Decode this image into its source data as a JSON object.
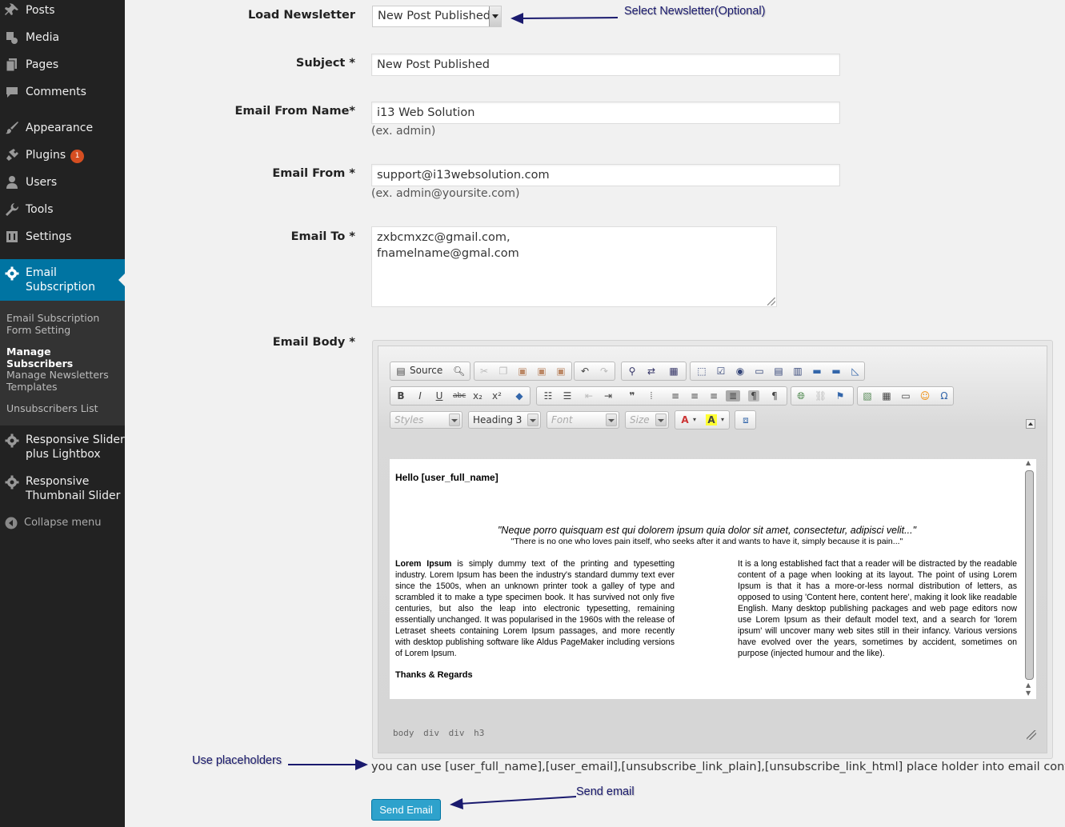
{
  "sidebar": {
    "items": [
      {
        "label": "Posts",
        "icon": "pushpin-icon"
      },
      {
        "label": "Media",
        "icon": "media-icon"
      },
      {
        "label": "Pages",
        "icon": "pages-icon"
      },
      {
        "label": "Comments",
        "icon": "comment-icon"
      },
      {
        "label": "Appearance",
        "icon": "paintbrush-icon"
      },
      {
        "label": "Plugins",
        "icon": "plugin-icon",
        "badge": "1"
      },
      {
        "label": "Users",
        "icon": "user-icon"
      },
      {
        "label": "Tools",
        "icon": "wrench-icon"
      },
      {
        "label": "Settings",
        "icon": "settings-icon"
      }
    ],
    "active": {
      "label": "Email Subscription",
      "icon": "gear-icon"
    },
    "submenu": [
      {
        "label": "Email Subscription Form Setting"
      },
      {
        "label": "Manage Subscribers"
      },
      {
        "label": "Manage Newsletters Templates"
      },
      {
        "label": "Unsubscribers List"
      }
    ],
    "more": [
      {
        "label": "Responsive Slider plus Lightbox",
        "icon": "gear-icon"
      },
      {
        "label": "Responsive Thumbnail Slider",
        "icon": "gear-icon"
      }
    ],
    "collapse_label": "Collapse menu",
    "colors": {
      "bg": "#222222",
      "active": "#0074a2",
      "badge": "#d54e21"
    }
  },
  "form": {
    "load_newsletter": {
      "label": "Load Newsletter",
      "value": "New Post Published"
    },
    "subject": {
      "label": "Subject *",
      "value": "New Post Published"
    },
    "from_name": {
      "label": "Email From Name*",
      "value": "i13 Web Solution",
      "hint": "(ex. admin)"
    },
    "email_from": {
      "label": "Email From *",
      "value": "support@i13websolution.com",
      "hint": "(ex. admin@yoursite.com)"
    },
    "email_to": {
      "label": "Email To *",
      "value": "zxbcmxzc@gmail.com,\nfnamelname@gmal.com"
    },
    "email_body": {
      "label": "Email Body *"
    },
    "help_text": "you can use [user_full_name],[user_email],[unsubscribe_link_plain],[unsubscribe_link_html] place holder into email content",
    "send_label": "Send Email"
  },
  "editor": {
    "source_label": "Source",
    "styles": "Styles",
    "format": "Heading 3",
    "font": "Font",
    "size": "Size",
    "path": "body div div h3",
    "content": {
      "greeting": "Hello [user_full_name]",
      "quote": "\"Neque porro quisquam est qui dolorem ipsum quia dolor sit amet, consectetur, adipisci velit...\"",
      "quote_sub": "\"There is no one who loves pain itself, who seeks after it and wants to have it, simply because it is pain...\"",
      "left_bold": "Lorem Ipsum",
      "left_text": " is simply dummy text of the printing and typesetting industry. Lorem Ipsum has been the industry's standard dummy text ever since the 1500s, when an unknown printer took a galley of type and scrambled it to make a type specimen book. It has survived not only five centuries, but also the leap into electronic typesetting, remaining essentially unchanged. It was popularised in the 1960s with the release of Letraset sheets containing Lorem Ipsum passages, and more recently with desktop publishing software like Aldus PageMaker including versions of Lorem Ipsum.",
      "right_text": "It is a long established fact that a reader will be distracted by the readable content of a page when looking at its layout. The point of using Lorem Ipsum is that it has a more-or-less normal distribution of letters, as opposed to using 'Content here, content here', making it look like readable English. Many desktop publishing packages and web page editors now use Lorem Ipsum as their default model text, and a search for 'lorem ipsum' will uncover many web sites still in their infancy. Various versions have evolved over the years, sometimes by accident, sometimes on purpose (injected humour and the like).",
      "regards": "Thanks & Regards"
    }
  },
  "annotations": {
    "select": "Select Newsletter(Optional)",
    "placeholders": "Use placeholders",
    "send": "Send email"
  }
}
